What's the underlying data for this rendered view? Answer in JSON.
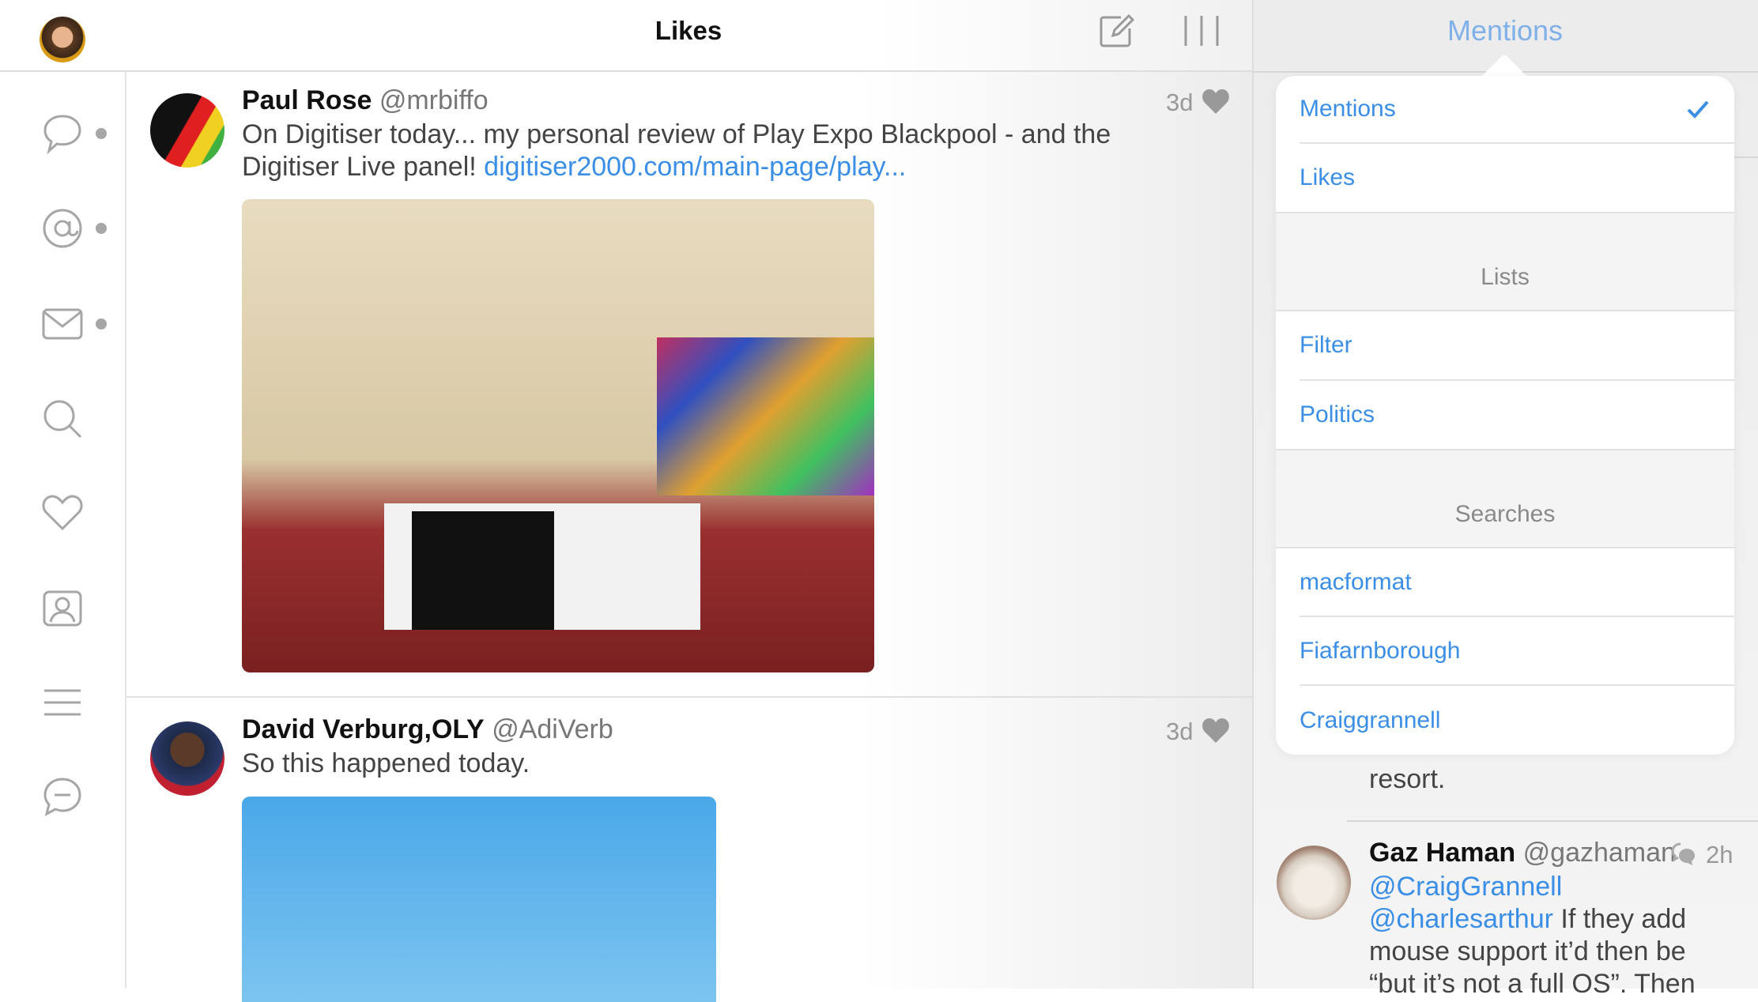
{
  "header": {
    "title": "Likes",
    "compose_icon": "compose-icon",
    "columns_icon": "columns-icon"
  },
  "sidebar": {
    "items": [
      {
        "name": "timeline",
        "icon": "speech-bubble-icon",
        "unread": true
      },
      {
        "name": "mentions",
        "icon": "at-icon",
        "unread": true
      },
      {
        "name": "messages",
        "icon": "envelope-icon",
        "unread": true
      },
      {
        "name": "search",
        "icon": "search-icon",
        "unread": false
      },
      {
        "name": "likes",
        "icon": "heart-icon",
        "unread": false
      },
      {
        "name": "profile",
        "icon": "profile-icon",
        "unread": false
      },
      {
        "name": "lists",
        "icon": "list-icon",
        "unread": false
      },
      {
        "name": "messages-alt",
        "icon": "chat-icon",
        "unread": false
      }
    ]
  },
  "tweets": [
    {
      "name": "Paul Rose",
      "handle": "@mrbiffo",
      "time": "3d",
      "text": "On Digitiser today... my personal review of Play Expo Blackpool - and the Digitiser Live panel!",
      "link": "digitiser2000.com/main-page/play..."
    },
    {
      "name": "David Verburg,OLY",
      "handle": "@AdiVerb",
      "time": "3d",
      "text": "So this happened today."
    }
  ],
  "right_panel": {
    "title": "Mentions",
    "behind_text": "resort.",
    "tweet": {
      "name": "Gaz Haman",
      "handle": "@gazhaman",
      "time": "2h",
      "mention1": "@CraigGrannell",
      "mention2": "@charlesarthur",
      "text1": " If they add",
      "text2": "mouse support it’d then be",
      "text3": "“but it’s not a full OS”. Then"
    }
  },
  "popover": {
    "items": [
      "Mentions",
      "Likes"
    ],
    "selected": "Mentions",
    "lists_header": "Lists",
    "lists": [
      "Filter",
      "Politics"
    ],
    "searches_header": "Searches",
    "searches": [
      "macformat",
      "Fiafarnborough",
      "Craiggrannell"
    ]
  },
  "colors": {
    "accent": "#3a8ee6",
    "icon": "#a6a6a6"
  }
}
